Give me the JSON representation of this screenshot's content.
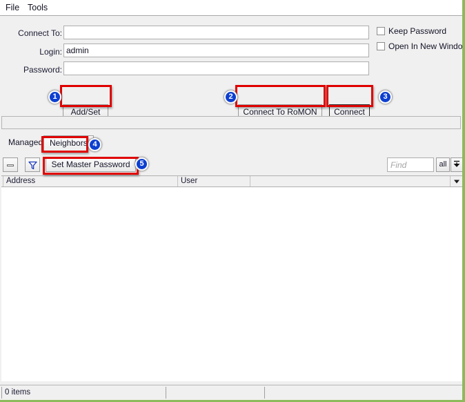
{
  "window": {
    "accent_border_color": "#8cba5b",
    "background_color": "#f0f0f0"
  },
  "menubar": {
    "items": [
      {
        "label": "File",
        "name": "menu-file"
      },
      {
        "label": "Tools",
        "name": "menu-tools"
      }
    ]
  },
  "form": {
    "fields": [
      {
        "label": "Connect To:",
        "value": "",
        "placeholder": ""
      },
      {
        "label": "Login:",
        "value": "admin",
        "placeholder": ""
      },
      {
        "label": "Password:",
        "value": "",
        "placeholder": ""
      }
    ],
    "checkboxes": [
      {
        "label": "Keep Password",
        "checked": false
      },
      {
        "label": "Open In New Window",
        "checked": false
      }
    ],
    "buttons": [
      {
        "label": "Add/Set"
      },
      {
        "label": "Connect To RoMON"
      },
      {
        "label": "Connect"
      }
    ]
  },
  "message_strip": {
    "text": ""
  },
  "tabs": [
    {
      "label": "Managed",
      "active": false
    },
    {
      "label": "Neighbors",
      "active": true
    }
  ],
  "toolbar": {
    "remove_icon": "minus-icon",
    "filter_icon": "funnel-icon",
    "set_master_password_label": "Set Master Password",
    "find": {
      "value": "",
      "placeholder": "Find"
    },
    "all_label": "all",
    "sort_icon": "arrow-down-bar-icon"
  },
  "table": {
    "columns": [
      {
        "label": "Address"
      },
      {
        "label": "User"
      },
      {
        "label": ""
      }
    ],
    "rows": []
  },
  "statusbar": {
    "items_text": "0 items",
    "middle_text": "",
    "right_text": ""
  },
  "annotations": {
    "badges": [
      {
        "number": "1",
        "target": "Add/Set"
      },
      {
        "number": "2",
        "target": "Connect To RoMON"
      },
      {
        "number": "3",
        "target": "Connect"
      },
      {
        "number": "4",
        "target": "Neighbors"
      },
      {
        "number": "5",
        "target": "Set Master Password"
      }
    ],
    "highlight_color": "#e00000",
    "badge_color": "#0d3fd0"
  }
}
